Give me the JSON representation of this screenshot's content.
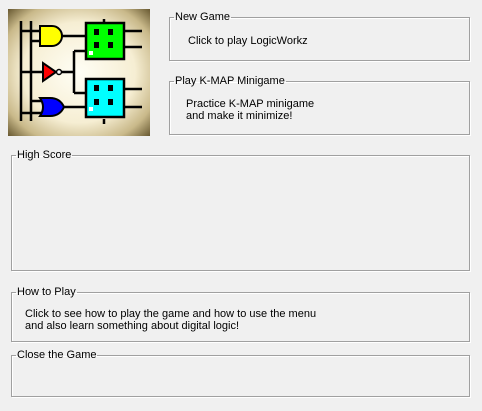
{
  "logo": {
    "icon": "logic-circuit-logo-icon",
    "colors": {
      "and_gate": "#ffff00",
      "not_gate": "#ff0000",
      "or_gate": "#0000ff",
      "chip_top": "#00ff00",
      "chip_bottom": "#00ffff",
      "bevel_light": "#fffbe6",
      "bevel_dark": "#6b5b2e"
    }
  },
  "new_game": {
    "title": "New Game",
    "description": "Click to play LogicWorkz"
  },
  "kmap": {
    "title": "Play K-MAP Minigame",
    "line1": "Practice K-MAP minigame",
    "line2": "and make it minimize!"
  },
  "high_score": {
    "title": "High Score"
  },
  "how_to_play": {
    "title": "How to Play",
    "line1": "Click to see how to play the game and how to use the menu",
    "line2": "and also learn something about digital logic!"
  },
  "close_game": {
    "title": "Close the Game"
  }
}
